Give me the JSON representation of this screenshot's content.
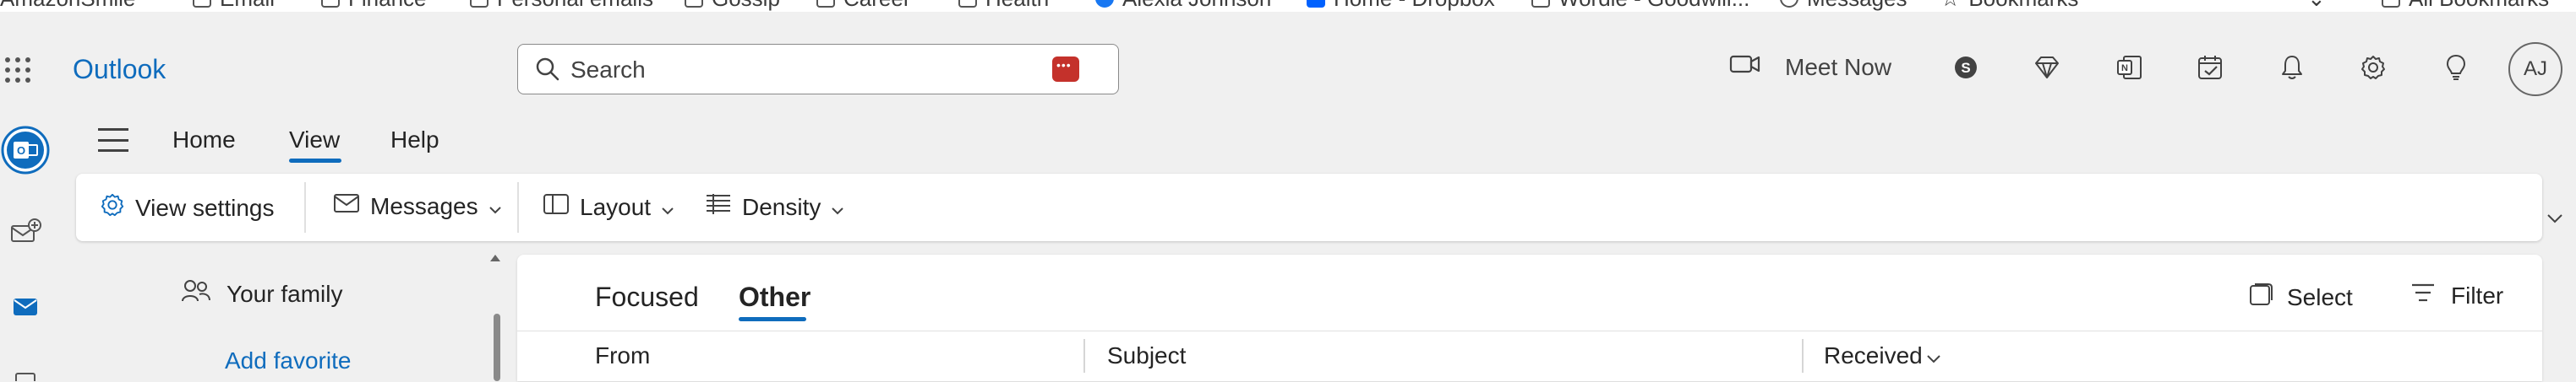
{
  "bookmarks": [
    {
      "label": "AmazonSmile"
    },
    {
      "label": "Email"
    },
    {
      "label": "Finance"
    },
    {
      "label": "Personal emails"
    },
    {
      "label": "Gossip"
    },
    {
      "label": "Career"
    },
    {
      "label": "Health"
    },
    {
      "label": "Alexia Johnson"
    },
    {
      "label": "Home - Dropbox"
    },
    {
      "label": "Wordle - Goodwill..."
    },
    {
      "label": "Messages"
    },
    {
      "label": "Bookmarks"
    },
    {
      "label": "All Bookmarks"
    }
  ],
  "header": {
    "app_name": "Outlook",
    "search_placeholder": "Search",
    "meet_now_label": "Meet Now",
    "avatar_initials": "AJ",
    "icons": [
      "skype-icon",
      "premium-diamond-icon",
      "onenote-icon",
      "todo-icon",
      "bell-icon",
      "gear-icon",
      "lightbulb-icon"
    ]
  },
  "ribbon_tabs": {
    "home": "Home",
    "view": "View",
    "help": "Help",
    "active": "View"
  },
  "ribbon": {
    "view_settings": "View settings",
    "messages": "Messages",
    "layout": "Layout",
    "density": "Density"
  },
  "folder_pane": {
    "your_family": "Your family",
    "add_favorite": "Add favorite"
  },
  "message_list": {
    "focused": "Focused",
    "other": "Other",
    "active_tab": "Other",
    "select": "Select",
    "filter": "Filter",
    "columns": {
      "from": "From",
      "subject": "Subject",
      "received": "Received"
    }
  },
  "colors": {
    "accent": "#0f6cbd",
    "record_red": "#c4312b"
  }
}
